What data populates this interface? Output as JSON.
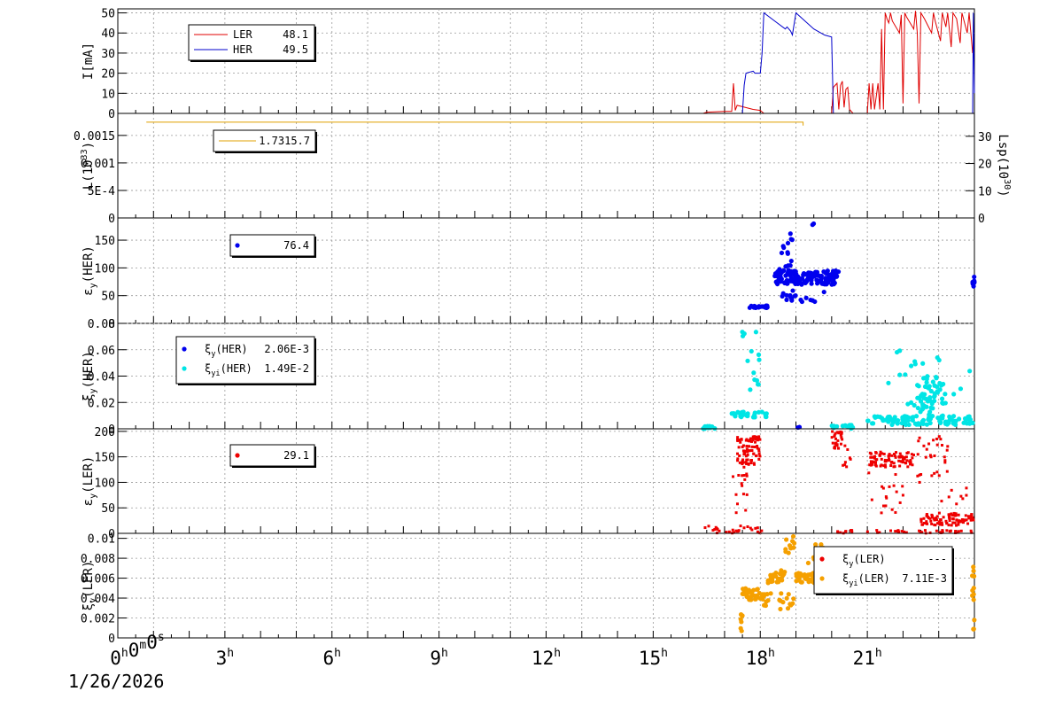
{
  "date_label": "1/26/2026",
  "x_axis": {
    "range_hours": [
      0,
      24
    ],
    "ticks": [
      {
        "h": 0,
        "label": "0h0m0s"
      },
      {
        "h": 3,
        "label": "3h"
      },
      {
        "h": 6,
        "label": "6h"
      },
      {
        "h": 9,
        "label": "9h"
      },
      {
        "h": 12,
        "label": "12h"
      },
      {
        "h": 15,
        "label": "15h"
      },
      {
        "h": 18,
        "label": "18h"
      },
      {
        "h": 21,
        "label": "21h"
      }
    ]
  },
  "colors": {
    "ler": "#e00000",
    "her": "#0000cc",
    "lum": "#e0a000",
    "her_yi": "#00e5e5",
    "ler_yi": "#f5a000"
  },
  "chart_data": [
    {
      "type": "line",
      "ylabel": "I[mA]",
      "ylim": [
        0,
        52
      ],
      "yticks": [
        {
          "v": 0,
          "label": "0"
        },
        {
          "v": 10,
          "label": "10"
        },
        {
          "v": 20,
          "label": "20"
        },
        {
          "v": 30,
          "label": "30"
        },
        {
          "v": 40,
          "label": "40"
        },
        {
          "v": 50,
          "label": "50"
        }
      ],
      "grid": true,
      "legend": "top-left",
      "series": [
        {
          "name": "LER",
          "readout": "48.1",
          "color": "#e00000",
          "points": [
            [
              0,
              0
            ],
            [
              16.4,
              0
            ],
            [
              16.5,
              0.6
            ],
            [
              17.0,
              1
            ],
            [
              17.2,
              1
            ],
            [
              17.25,
              15
            ],
            [
              17.3,
              1.5
            ],
            [
              17.35,
              4
            ],
            [
              17.8,
              2
            ],
            [
              18.0,
              1.5
            ],
            [
              18.1,
              0
            ],
            [
              20.0,
              0
            ],
            [
              20.05,
              13
            ],
            [
              20.15,
              15
            ],
            [
              20.2,
              2
            ],
            [
              20.25,
              14
            ],
            [
              20.3,
              16
            ],
            [
              20.35,
              3
            ],
            [
              20.4,
              12
            ],
            [
              20.45,
              13
            ],
            [
              20.5,
              2
            ],
            [
              20.6,
              0
            ],
            [
              21.0,
              0
            ],
            [
              21.05,
              15
            ],
            [
              21.1,
              2
            ],
            [
              21.15,
              15
            ],
            [
              21.2,
              2
            ],
            [
              21.3,
              15
            ],
            [
              21.35,
              2
            ],
            [
              21.4,
              42
            ],
            [
              21.45,
              2
            ],
            [
              21.5,
              50
            ],
            [
              21.55,
              47
            ],
            [
              21.6,
              45
            ],
            [
              21.65,
              50
            ],
            [
              21.7,
              46
            ],
            [
              21.9,
              40
            ],
            [
              21.95,
              49
            ],
            [
              22.0,
              5
            ],
            [
              22.05,
              50
            ],
            [
              22.1,
              48
            ],
            [
              22.3,
              42
            ],
            [
              22.35,
              51
            ],
            [
              22.4,
              40
            ],
            [
              22.45,
              5
            ],
            [
              22.5,
              50
            ],
            [
              22.6,
              47
            ],
            [
              22.8,
              40
            ],
            [
              22.85,
              50
            ],
            [
              22.9,
              46
            ],
            [
              23.05,
              36
            ],
            [
              23.1,
              50
            ],
            [
              23.2,
              43
            ],
            [
              23.25,
              50
            ],
            [
              23.35,
              33
            ],
            [
              23.4,
              50
            ],
            [
              23.5,
              47
            ],
            [
              23.6,
              35
            ],
            [
              23.65,
              50
            ],
            [
              23.8,
              40
            ],
            [
              23.85,
              50
            ],
            [
              23.95,
              30
            ]
          ]
        },
        {
          "name": "HER",
          "readout": "49.5",
          "color": "#0000cc",
          "points": [
            [
              0,
              0
            ],
            [
              17.5,
              0
            ],
            [
              17.55,
              14
            ],
            [
              17.6,
              20
            ],
            [
              17.8,
              21
            ],
            [
              17.85,
              20
            ],
            [
              18.0,
              20
            ],
            [
              18.05,
              30
            ],
            [
              18.1,
              50
            ],
            [
              18.4,
              46
            ],
            [
              18.7,
              42
            ],
            [
              18.75,
              43
            ],
            [
              18.85,
              41
            ],
            [
              18.9,
              39
            ],
            [
              19.0,
              50
            ],
            [
              19.5,
              42
            ],
            [
              19.8,
              39
            ],
            [
              20.0,
              38
            ],
            [
              20.05,
              0
            ],
            [
              23.95,
              0
            ],
            [
              23.97,
              50
            ],
            [
              24.0,
              10
            ]
          ]
        }
      ]
    },
    {
      "type": "line",
      "ylabel": "L(10^33)",
      "y2label": "Lsp(10^30)",
      "ylim": [
        0,
        0.0019
      ],
      "yticks": [
        {
          "v": 0,
          "label": "0"
        },
        {
          "v": 0.0005,
          "label": "5E-4"
        },
        {
          "v": 0.001,
          "label": "0.001"
        },
        {
          "v": 0.0015,
          "label": "0.0015"
        }
      ],
      "y2ticks": [
        {
          "v": 0,
          "label": "0"
        },
        {
          "v": 10,
          "label": "10"
        },
        {
          "v": 20,
          "label": "20"
        },
        {
          "v": 30,
          "label": "30"
        }
      ],
      "y2lim": [
        0,
        38.4
      ],
      "grid": true,
      "legend": "top-left",
      "legend_text": "1.7315.7",
      "series": [
        {
          "name": "",
          "color": "#e0a000",
          "points": [
            [
              0.8,
              0.00174
            ],
            [
              19.2,
              0.00174
            ],
            [
              19.2,
              0.00168
            ]
          ]
        }
      ]
    },
    {
      "type": "scatter",
      "ylabel": "εy(HER)",
      "ylim": [
        0,
        190
      ],
      "yticks": [
        {
          "v": 0,
          "label": "0"
        },
        {
          "v": 50,
          "label": "50"
        },
        {
          "v": 100,
          "label": "100"
        },
        {
          "v": 150,
          "label": "150"
        }
      ],
      "grid": true,
      "legend": "top-left",
      "series": [
        {
          "name": "",
          "readout": "76.4",
          "color": "#0000ee",
          "mode": "blob",
          "clusters": [
            {
              "x": [
                17.7,
                18.2
              ],
              "y": [
                28,
                32
              ],
              "n": 25
            },
            {
              "x": [
                18.4,
                18.9
              ],
              "y": [
                70,
                105
              ],
              "n": 50
            },
            {
              "x": [
                18.9,
                20.2
              ],
              "y": [
                70,
                95
              ],
              "n": 110
            },
            {
              "x": [
                18.6,
                19.8
              ],
              "y": [
                35,
                60
              ],
              "n": 18
            },
            {
              "x": [
                18.5,
                18.9
              ],
              "y": [
                110,
                180
              ],
              "n": 10
            },
            {
              "x": [
                19.4,
                19.5
              ],
              "y": [
                170,
                182
              ],
              "n": 2
            },
            {
              "x": [
                23.95,
                24.0
              ],
              "y": [
                65,
                90
              ],
              "n": 10
            }
          ]
        }
      ]
    },
    {
      "type": "scatter",
      "ylabel": "ξy(HER)",
      "ylim": [
        0,
        0.08
      ],
      "yticks": [
        {
          "v": 0,
          "label": "0"
        },
        {
          "v": 0.02,
          "label": "0.02"
        },
        {
          "v": 0.04,
          "label": "0.04"
        },
        {
          "v": 0.06,
          "label": "0.06"
        },
        {
          "v": 0.08,
          "label": "0.08"
        }
      ],
      "grid": true,
      "legend": "top-left",
      "series": [
        {
          "name": "ξy(HER)",
          "readout": "2.06E-3",
          "color": "#0000ee",
          "mode": "blob",
          "clusters": [
            {
              "x": [
                19.05,
                19.1
              ],
              "y": [
                0,
                0.002
              ],
              "n": 2
            }
          ]
        },
        {
          "name": "ξyi(HER)",
          "readout": "1.49E-2",
          "color": "#00e5e5",
          "mode": "blob",
          "clusters": [
            {
              "x": [
                16.4,
                17.0
              ],
              "y": [
                0,
                0.002
              ],
              "n": 14
            },
            {
              "x": [
                17.2,
                18.2
              ],
              "y": [
                0.008,
                0.013
              ],
              "n": 30
            },
            {
              "x": [
                17.4,
                18.0
              ],
              "y": [
                0.02,
                0.078
              ],
              "n": 14
            },
            {
              "x": [
                20.0,
                20.6
              ],
              "y": [
                0,
                0.003
              ],
              "n": 12
            },
            {
              "x": [
                21.0,
                24.0
              ],
              "y": [
                0.003,
                0.01
              ],
              "n": 90
            },
            {
              "x": [
                22.4,
                23.2
              ],
              "y": [
                0.008,
                0.04
              ],
              "n": 55
            },
            {
              "x": [
                21.5,
                23.9
              ],
              "y": [
                0.015,
                0.06
              ],
              "n": 22
            }
          ]
        }
      ]
    },
    {
      "type": "scatter",
      "ylabel": "εy(LER)",
      "ylim": [
        0,
        205
      ],
      "yticks": [
        {
          "v": 0,
          "label": "0"
        },
        {
          "v": 50,
          "label": "50"
        },
        {
          "v": 100,
          "label": "100"
        },
        {
          "v": 150,
          "label": "150"
        },
        {
          "v": 200,
          "label": "200"
        }
      ],
      "grid": true,
      "legend": "top-left",
      "series": [
        {
          "name": "",
          "readout": "29.1",
          "color": "#ee0000",
          "mode": "sq",
          "clusters": [
            {
              "x": [
                16.4,
                18.1
              ],
              "y": [
                0,
                15
              ],
              "n": 28
            },
            {
              "x": [
                17.35,
                18.0
              ],
              "y": [
                135,
                190
              ],
              "n": 85
            },
            {
              "x": [
                17.2,
                17.7
              ],
              "y": [
                20,
                130
              ],
              "n": 16
            },
            {
              "x": [
                20.0,
                20.3
              ],
              "y": [
                165,
                200
              ],
              "n": 28
            },
            {
              "x": [
                20.3,
                20.6
              ],
              "y": [
                130,
                175
              ],
              "n": 8
            },
            {
              "x": [
                20.0,
                20.6
              ],
              "y": [
                0,
                8
              ],
              "n": 10
            },
            {
              "x": [
                21.05,
                22.3
              ],
              "y": [
                130,
                160
              ],
              "n": 85
            },
            {
              "x": [
                21.0,
                22.0
              ],
              "y": [
                40,
                120
              ],
              "n": 18
            },
            {
              "x": [
                22.4,
                23.3
              ],
              "y": [
                100,
                190
              ],
              "n": 30
            },
            {
              "x": [
                22.5,
                24.0
              ],
              "y": [
                15,
                40
              ],
              "n": 95
            },
            {
              "x": [
                21.0,
                24.0
              ],
              "y": [
                0,
                6
              ],
              "n": 35
            },
            {
              "x": [
                23.0,
                23.8
              ],
              "y": [
                50,
                90
              ],
              "n": 8
            }
          ]
        }
      ]
    },
    {
      "type": "scatter",
      "ylabel": "ξy(LER)",
      "ylim": [
        0,
        0.0105
      ],
      "yticks": [
        {
          "v": 0,
          "label": "0"
        },
        {
          "v": 0.002,
          "label": "0.002"
        },
        {
          "v": 0.004,
          "label": "0.004"
        },
        {
          "v": 0.006,
          "label": "0.006"
        },
        {
          "v": 0.008,
          "label": "0.008"
        },
        {
          "v": 0.01,
          "label": "0.01"
        }
      ],
      "grid": true,
      "legend": "top-right",
      "series": [
        {
          "name": "ξy(LER)",
          "readout": "---",
          "color": "#ee0000",
          "mode": "blob",
          "clusters": []
        },
        {
          "name": "ξyi(LER)",
          "readout": "7.11E-3",
          "color": "#f5a000",
          "mode": "blob",
          "clusters": [
            {
              "x": [
                17.45,
                17.5
              ],
              "y": [
                0,
                0.0025
              ],
              "n": 6
            },
            {
              "x": [
                17.5,
                18.1
              ],
              "y": [
                0.0038,
                0.005
              ],
              "n": 35
            },
            {
              "x": [
                18.0,
                18.3
              ],
              "y": [
                0.003,
                0.0045
              ],
              "n": 10
            },
            {
              "x": [
                18.2,
                18.7
              ],
              "y": [
                0.0055,
                0.0068
              ],
              "n": 25
            },
            {
              "x": [
                18.7,
                19.0
              ],
              "y": [
                0.0085,
                0.0102
              ],
              "n": 10
            },
            {
              "x": [
                18.5,
                19.0
              ],
              "y": [
                0.0025,
                0.0045
              ],
              "n": 12
            },
            {
              "x": [
                19.0,
                19.8
              ],
              "y": [
                0.0055,
                0.0065
              ],
              "n": 35
            },
            {
              "x": [
                19.8,
                20.2
              ],
              "y": [
                0.005,
                0.006
              ],
              "n": 18
            },
            {
              "x": [
                19.3,
                20.0
              ],
              "y": [
                0.0072,
                0.0095
              ],
              "n": 10
            },
            {
              "x": [
                23.93,
                24.0
              ],
              "y": [
                0.0003,
                0.0072
              ],
              "n": 12
            }
          ]
        }
      ]
    }
  ]
}
